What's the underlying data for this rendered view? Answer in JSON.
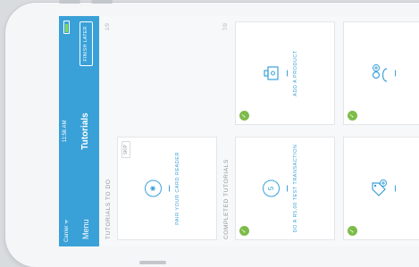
{
  "status_bar": {
    "carrier": "Carrier ᯤ",
    "time": "11:56 AM"
  },
  "nav_bar": {
    "menu_label": "Menu",
    "title": "Tutorials",
    "finish_later_label": "FINISH LATER"
  },
  "todo_section": {
    "label": "TUTORIALS TO DO",
    "count": "1/9",
    "cards": [
      {
        "label": "PAIR YOUR CARD READER",
        "icon": "bluetooth-icon",
        "skip_label": "SKIP"
      }
    ]
  },
  "completed_section": {
    "label": "COMPLETED TUTORIALS",
    "count": "7/9",
    "cards": [
      {
        "label": "DO A R5,00 TEST TRANSACTION",
        "icon": "coin-icon",
        "complete": true
      },
      {
        "label": "ADD A PRODUCT",
        "icon": "product-box-icon",
        "complete": true
      },
      {
        "label": "",
        "icon": "tag-add-icon",
        "complete": true
      },
      {
        "label": "",
        "icon": "user-add-icon",
        "complete": true
      }
    ]
  },
  "colors": {
    "accent": "#3aa1d8",
    "complete_badge": "#7dbb4a",
    "battery": "#7ed957"
  }
}
